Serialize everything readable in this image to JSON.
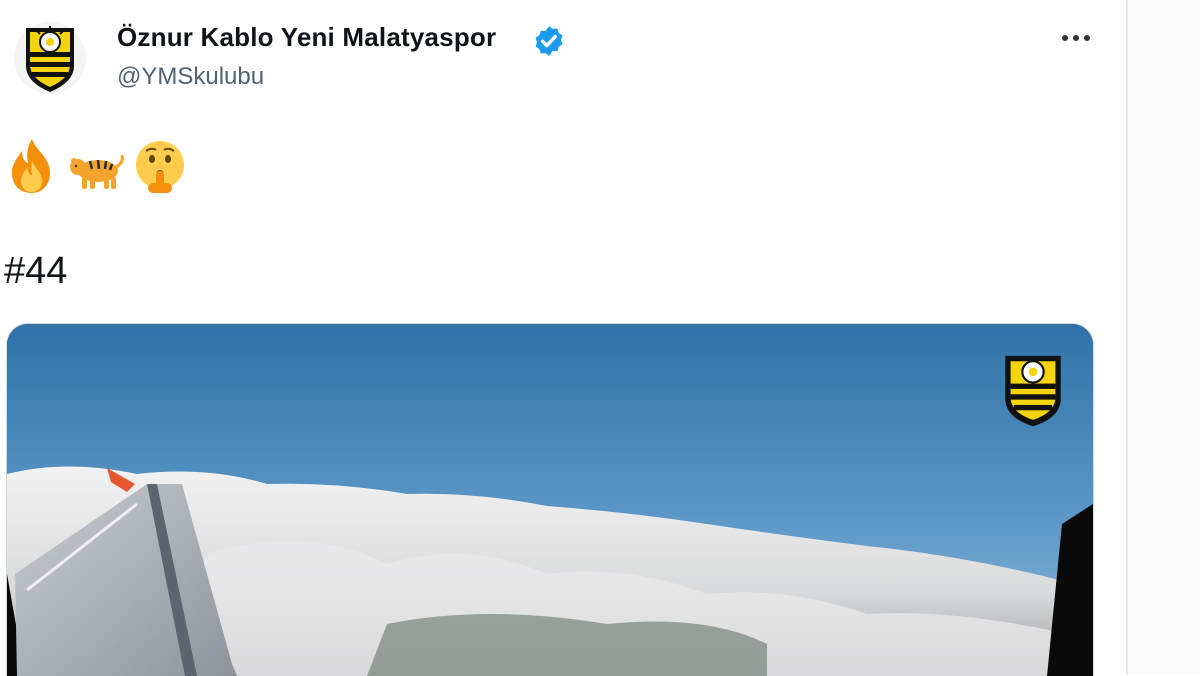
{
  "tweet": {
    "author": {
      "display_name": "Öznur Kablo Yeni Malatyaspor",
      "handle": "@YMSkulubu",
      "verified": true,
      "avatar_icon": "yeni-malatyaspor-crest"
    },
    "more_icon": "more-horizontal-icon",
    "emojis": [
      "fire",
      "tiger",
      "shushing-face"
    ],
    "hashtag": "#44",
    "media": {
      "type": "video",
      "scene": "airplane-wing-above-clouds",
      "watermark_icon": "yeni-malatyaspor-crest"
    }
  },
  "colors": {
    "verified_blue": "#1d9bf0",
    "club_yellow": "#f5d40c",
    "club_black": "#111111",
    "handle_gray": "#536471",
    "sky_top": "#2f73a8",
    "sky_bottom": "#7fb3d6"
  }
}
